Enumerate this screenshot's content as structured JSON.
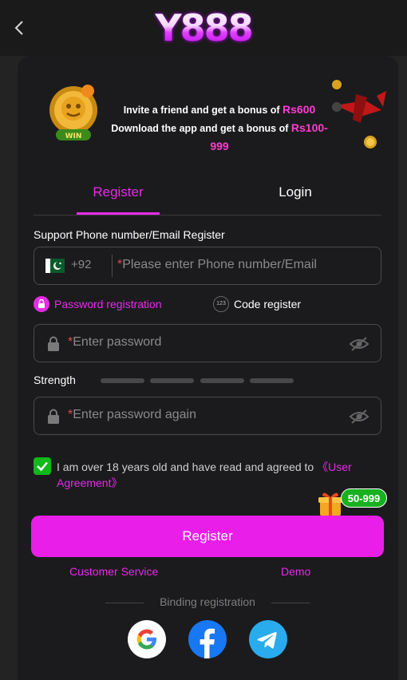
{
  "header": {
    "logo_text": "Y888",
    "back_icon": "chevron-left-icon"
  },
  "banner": {
    "line1_prefix": "Invite a friend and get a bonus of",
    "line1_amount": "Rs600",
    "line2_prefix": "Download the app and get a bonus of",
    "line2_amount": "Rs100-999",
    "coin_badge_text": "WIN"
  },
  "tabs": [
    {
      "label": "Register",
      "active": true
    },
    {
      "label": "Login",
      "active": false
    }
  ],
  "form": {
    "section_label": "Support Phone number/Email Register",
    "country_code": "+92",
    "phone_placeholder": "Please enter Phone number/Email",
    "required_mark": "*",
    "mode_password_label": "Password registration",
    "mode_code_label": "Code register",
    "mode_code_icon_text": "123",
    "password_placeholder": "Enter password",
    "strength_label": "Strength",
    "password_again_placeholder": "Enter password again",
    "agreement_text": "I am over 18 years old and have read and agreed to ",
    "agreement_link": "《User Agreement》",
    "agreement_checked": true
  },
  "bonus_badge": "50-999",
  "register_button": "Register",
  "links": {
    "customer_service": "Customer Service",
    "demo": "Demo"
  },
  "binding_label": "Binding registration",
  "social": [
    {
      "icon": "google-icon"
    },
    {
      "icon": "facebook-icon"
    },
    {
      "icon": "telegram-icon"
    }
  ],
  "colors": {
    "accent": "#e82ae9",
    "check": "#11b81a",
    "background": "#1b1b1d"
  }
}
